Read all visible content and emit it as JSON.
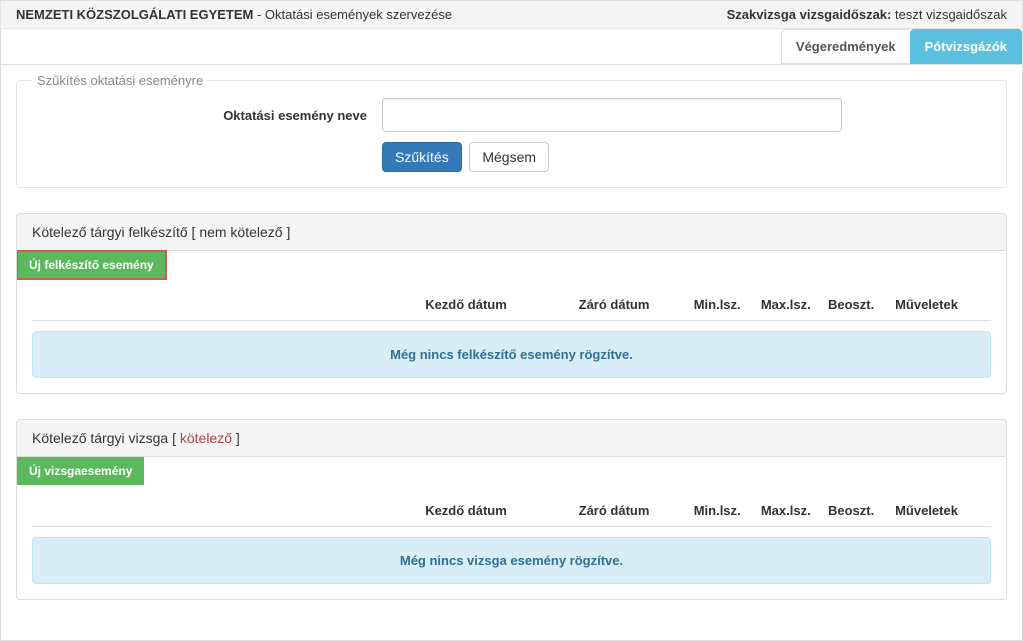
{
  "header": {
    "title_bold": "NEMZETI KÖZSZOLGÁLATI EGYETEM",
    "title_suffix": " - Oktatási események szervezése",
    "right_label": "Szakvizsga vizsgaidőszak:",
    "right_value": "teszt vizsgaidőszak"
  },
  "tabs": {
    "final_results": "Végeredmények",
    "resit": "Pótvizsgázók"
  },
  "filter": {
    "legend": "Szűkítés oktatási eseményre",
    "label": "Oktatási esemény neve",
    "input_value": "",
    "btn_filter": "Szűkítés",
    "btn_cancel": "Mégsem"
  },
  "columns": {
    "kezdo": "Kezdő dátum",
    "zaro": "Záró dátum",
    "min": "Min.lsz.",
    "max": "Max.lsz.",
    "beoszt": "Beoszt.",
    "muveletek": "Műveletek"
  },
  "section1": {
    "title_prefix": "Kötelező tárgyi felkészítő [ ",
    "title_tag": "nem kötelező",
    "title_suffix": " ]",
    "btn_new": "Új felkészítő esemény",
    "empty_msg": "Még nincs felkészítő esemény rögzítve."
  },
  "section2": {
    "title_prefix": "Kötelező tárgyi vizsga [ ",
    "title_tag": "kötelező",
    "title_suffix": " ]",
    "btn_new": "Új vizsgaesemény",
    "empty_msg": "Még nincs vizsga esemény rögzítve."
  }
}
